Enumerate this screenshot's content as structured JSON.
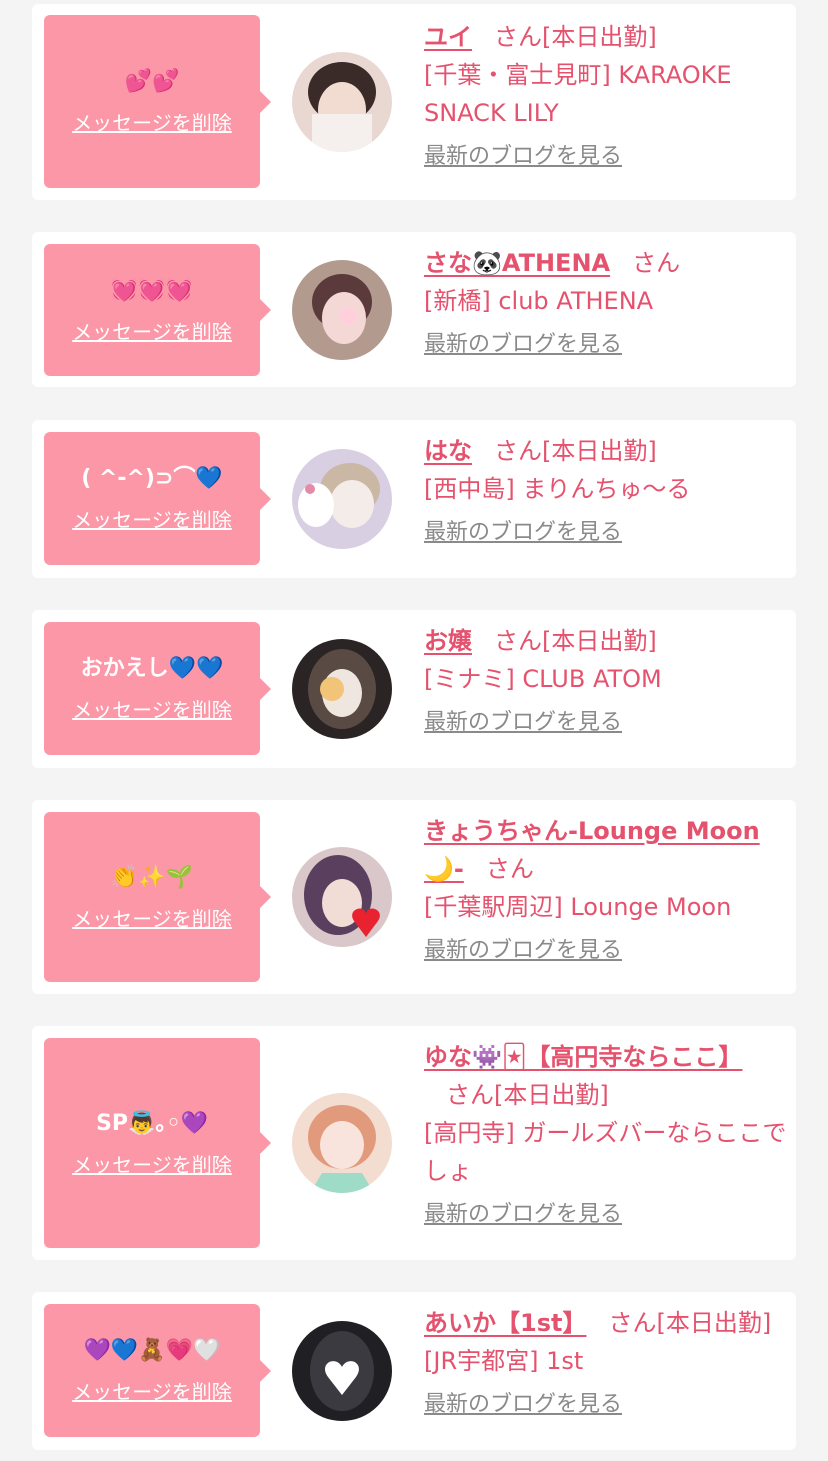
{
  "labels": {
    "delete": "メッセージを削除",
    "blog": "最新のブログを見る",
    "san": "さん"
  },
  "cards": [
    {
      "message": "💕💕",
      "name": "ユイ",
      "tag": "[本日出勤]",
      "shop": "[千葉・富士見町] KARAOKE SNACK LILY",
      "avatar_colors": [
        "#e9d7d2",
        "#3a2a28",
        "#f2dcd2"
      ]
    },
    {
      "message": "💓💓💓",
      "name": "さな🐼ATHENA",
      "tag": "",
      "shop": "[新橋] club ATHENA",
      "avatar_colors": [
        "#b39a8e",
        "#5a3a3a",
        "#f4d8d6"
      ]
    },
    {
      "message": "( ^-^)⊃⌒💙",
      "name": "はな",
      "tag": "[本日出勤]",
      "shop": "[西中島] まりんちゅ〜る",
      "avatar_colors": [
        "#d8cfe2",
        "#b08fb0",
        "#f4ece8"
      ]
    },
    {
      "message": "おかえし💙💙",
      "name": "お嬢",
      "tag": "[本日出勤]",
      "shop": "[ミナミ] CLUB ATOM",
      "avatar_colors": [
        "#2a2424",
        "#5a4a44",
        "#f1d9b8"
      ]
    },
    {
      "message": "👏✨🌱",
      "name": "きょうちゃん-Lounge Moon🌙-",
      "tag": "",
      "shop": "[千葉駅周辺] Lounge Moon",
      "avatar_colors": [
        "#d9c7c9",
        "#5b3f5e",
        "#e8232f"
      ]
    },
    {
      "message": "SP👼｡◦💜",
      "name": "ゆな👾🃏【高円寺ならここ】",
      "tag": "[本日出勤]",
      "shop": "[高円寺] ガールズバーならここでしょ",
      "avatar_colors": [
        "#f3dcd0",
        "#e29a7c",
        "#9fdcc8"
      ]
    },
    {
      "message": "💜💙🧸💗🤍",
      "name": "あいか【1st】",
      "tag": "[本日出勤]",
      "shop": "[JR宇都宮] 1st",
      "avatar_colors": [
        "#1f1f24",
        "#3a3a40",
        "#ffffff"
      ]
    }
  ]
}
